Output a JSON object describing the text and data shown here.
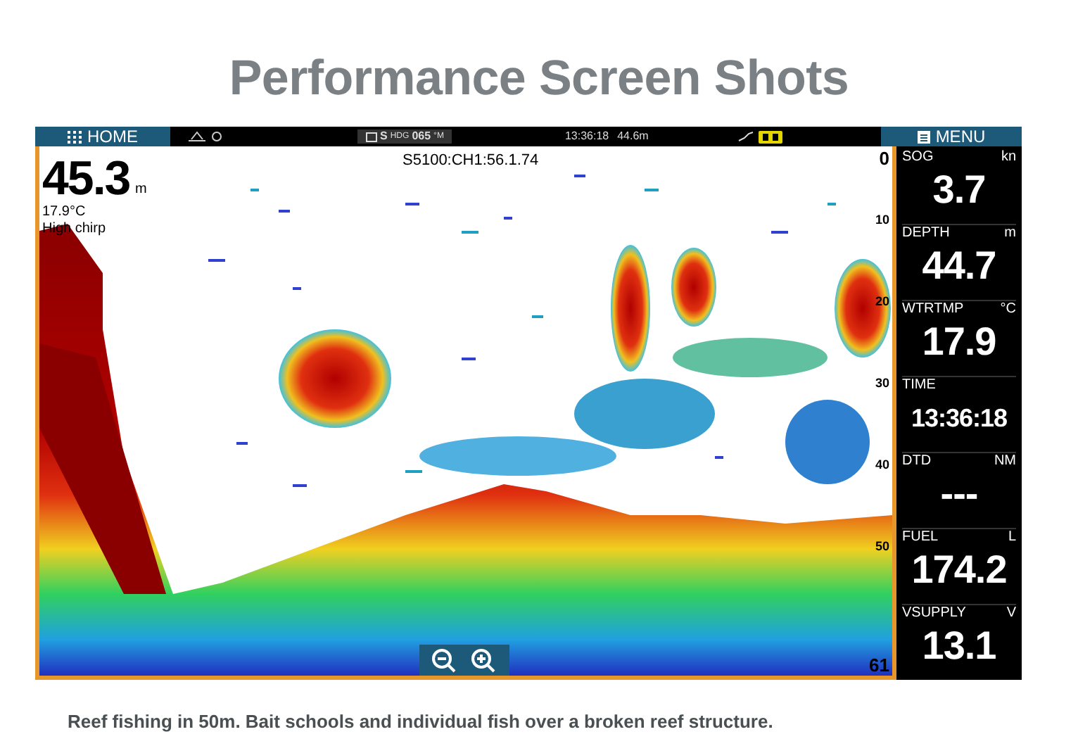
{
  "page_title": "Performance Screen Shots",
  "sonar": {
    "home_button": "HOME",
    "menu_button": "MENU",
    "status_bar": {
      "heading_dir": "S",
      "heading_label": "HDG",
      "heading_value": "065",
      "heading_unit": "°M",
      "time": "13:36:18",
      "depth": "44.6m"
    },
    "depth_reading": "45.3",
    "depth_unit": "m",
    "water_temp": "17.9°C",
    "mode": "High chirp",
    "channel": "S5100:CH1:56.1.74",
    "scale": [
      "0",
      "10",
      "20",
      "30",
      "40",
      "50",
      "61"
    ],
    "instruments": [
      {
        "label": "SOG",
        "unit": "kn",
        "value": "3.7"
      },
      {
        "label": "DEPTH",
        "unit": "m",
        "value": "44.7"
      },
      {
        "label": "WTRTMP",
        "unit": "°C",
        "value": "17.9"
      },
      {
        "label": "TIME",
        "value": "13:36:18"
      },
      {
        "label": "DTD",
        "unit": "NM",
        "value": "---"
      },
      {
        "label": "FUEL",
        "unit": "L",
        "value": "174.2"
      },
      {
        "label": "VSUPPLY",
        "unit": "V",
        "value": "13.1"
      }
    ]
  },
  "caption": "Reef fishing in 50m. Bait schools and individual fish over a broken reef structure."
}
